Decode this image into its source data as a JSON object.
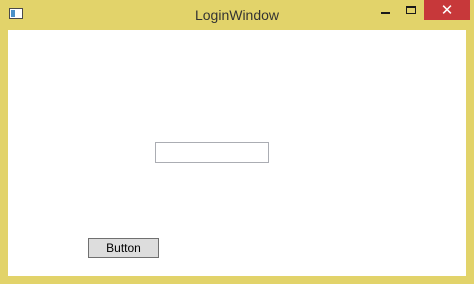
{
  "window": {
    "title": "LoginWindow",
    "frame_color": "#e2d36a",
    "close_color": "#c7383a",
    "icon": "app-window-icon"
  },
  "controls": {
    "minimize_icon": "minimize-icon",
    "maximize_icon": "maximize-icon",
    "close_glyph": "✕"
  },
  "form": {
    "text_input": {
      "value": "",
      "placeholder": ""
    },
    "button_label": "Button"
  }
}
